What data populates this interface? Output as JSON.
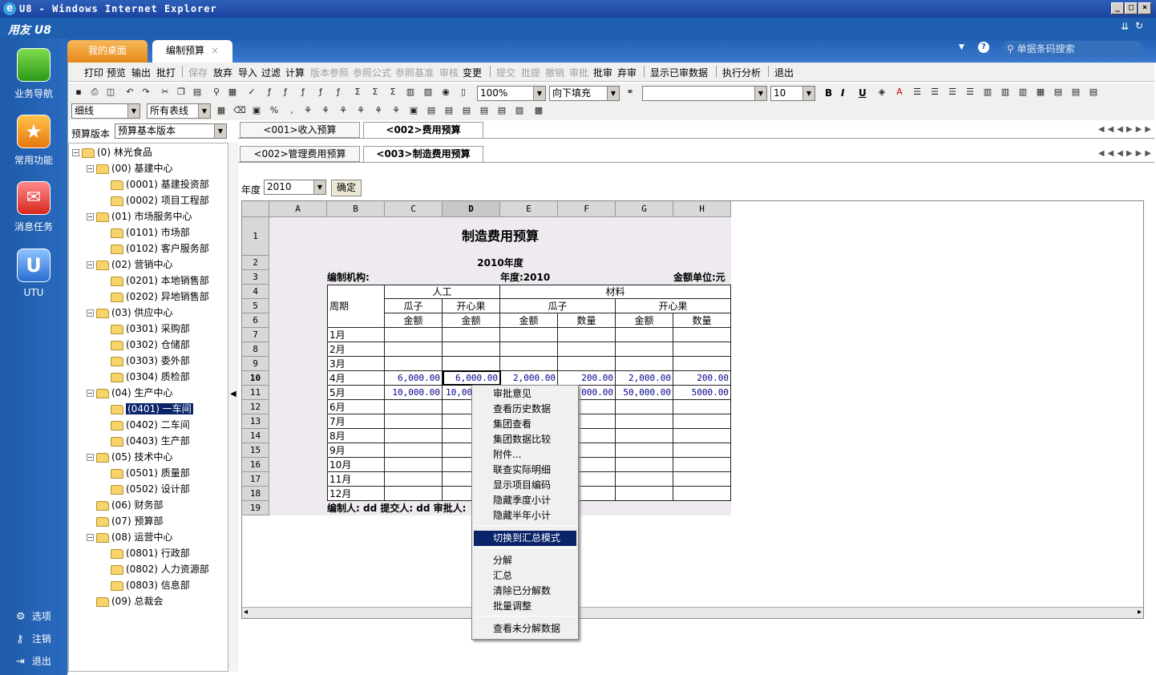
{
  "window": {
    "title": "U8 - Windows Internet Explorer"
  },
  "brand": {
    "name": "用友 U8"
  },
  "leftnav": {
    "items": [
      {
        "label": "业务导航"
      },
      {
        "label": "常用功能"
      },
      {
        "label": "消息任务"
      },
      {
        "label": "UTU"
      }
    ],
    "bottom": [
      {
        "label": "选项"
      },
      {
        "label": "注销"
      },
      {
        "label": "退出"
      }
    ]
  },
  "tabs": [
    {
      "label": "我的桌面"
    },
    {
      "label": "编制预算"
    }
  ],
  "search": {
    "placeholder": "单据条码搜索"
  },
  "menu": {
    "items": [
      "打印",
      "预览",
      "输出",
      "批打",
      "保存",
      "放弃",
      "导入",
      "过滤",
      "计算",
      "版本参照",
      "参照公式",
      "参照基准",
      "审核",
      "变更",
      "提交",
      "批提",
      "撤销",
      "审批",
      "批审",
      "弃审",
      "显示已审数据",
      "执行分析",
      "退出"
    ]
  },
  "toolbar": {
    "zoom": "100%",
    "fill": "向下填充",
    "font_size": "10",
    "line_style": "细线",
    "border": "所有表线"
  },
  "version": {
    "label": "预算版本",
    "value": "预算基本版本"
  },
  "tree": [
    {
      "label": "(0) 林光食品"
    },
    {
      "label": "(00) 基建中心"
    },
    {
      "label": "(0001) 基建投资部"
    },
    {
      "label": "(0002) 项目工程部"
    },
    {
      "label": "(01) 市场服务中心"
    },
    {
      "label": "(0101) 市场部"
    },
    {
      "label": "(0102) 客户服务部"
    },
    {
      "label": "(02) 营销中心"
    },
    {
      "label": "(0201) 本地销售部"
    },
    {
      "label": "(0202) 异地销售部"
    },
    {
      "label": "(03) 供应中心"
    },
    {
      "label": "(0301) 采购部"
    },
    {
      "label": "(0302) 仓储部"
    },
    {
      "label": "(0303) 委外部"
    },
    {
      "label": "(0304) 质检部"
    },
    {
      "label": "(04) 生产中心"
    },
    {
      "label": "(0401) 一车间"
    },
    {
      "label": "(0402) 二车间"
    },
    {
      "label": "(0403) 生产部"
    },
    {
      "label": "(05) 技术中心"
    },
    {
      "label": "(0501) 质量部"
    },
    {
      "label": "(0502) 设计部"
    },
    {
      "label": "(06) 财务部"
    },
    {
      "label": "(07) 预算部"
    },
    {
      "label": "(08) 运营中心"
    },
    {
      "label": "(0801) 行政部"
    },
    {
      "label": "(0802) 人力资源部"
    },
    {
      "label": "(0803) 信息部"
    },
    {
      "label": "(09) 总裁会"
    }
  ],
  "sheettabs1": [
    {
      "label": "<001>收入预算"
    },
    {
      "label": "<002>费用预算"
    }
  ],
  "sheettabs2": [
    {
      "label": "<002>管理费用预算"
    },
    {
      "label": "<003>制造费用预算"
    }
  ],
  "yearrow": {
    "label": "年度",
    "value": "2010",
    "confirm": "确定"
  },
  "sheet": {
    "cols": [
      "A",
      "B",
      "C",
      "D",
      "E",
      "F",
      "G",
      "H"
    ],
    "rows": [
      "1",
      "2",
      "3",
      "4",
      "5",
      "6",
      "7",
      "8",
      "9",
      "10",
      "11",
      "12",
      "13",
      "14",
      "15",
      "16",
      "17",
      "18",
      "19"
    ],
    "title": "制造费用预算",
    "subtitle": "2010年度",
    "org_label": "编制机构:",
    "year_label": "年度:2010",
    "unit_label": "金额单位:元",
    "period": "周期",
    "labor": "人工",
    "material": "材料",
    "guazi": "瓜子",
    "kaixinguo": "开心果",
    "amount": "金额",
    "qty": "数量",
    "months": [
      "1月",
      "2月",
      "3月",
      "4月",
      "5月",
      "6月",
      "7月",
      "8月",
      "9月",
      "10月",
      "11月",
      "12月"
    ],
    "r10": [
      "6,000.00",
      "6,000.00",
      "2,000.00",
      "200.00",
      "2,000.00",
      "200.00"
    ],
    "r11": [
      "10,000.00",
      "10,000.00",
      "000.00",
      "50,000.00",
      "5000.00"
    ],
    "footer": "编制人: dd 提交人: dd 审批人:"
  },
  "contextmenu": {
    "items": [
      "审批意见",
      "查看历史数据",
      "集团查看",
      "集团数据比较",
      "附件...",
      "联查实际明细",
      "显示项目编码",
      "隐藏季度小计",
      "隐藏半年小计",
      "切换到汇总模式",
      "分解",
      "汇总",
      "清除已分解数",
      "批量调整",
      "查看未分解数据"
    ]
  }
}
